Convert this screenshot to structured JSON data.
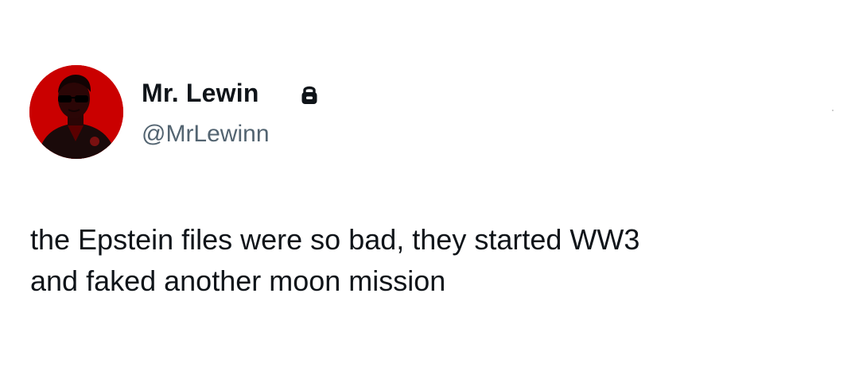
{
  "author": {
    "display_name": "Mr. Lewin",
    "handle": "@MrLewinn",
    "avatar_icon": "person-avatar-red",
    "account_icon": "lock-icon"
  },
  "tweet": {
    "text_lines": [
      "the Epstein files were so bad, they started WW3",
      "and faked another moon mission"
    ]
  },
  "colors": {
    "background": "#ffffff",
    "text_primary": "#0f1419",
    "text_secondary": "#536471",
    "avatar_red": "#d40000"
  }
}
